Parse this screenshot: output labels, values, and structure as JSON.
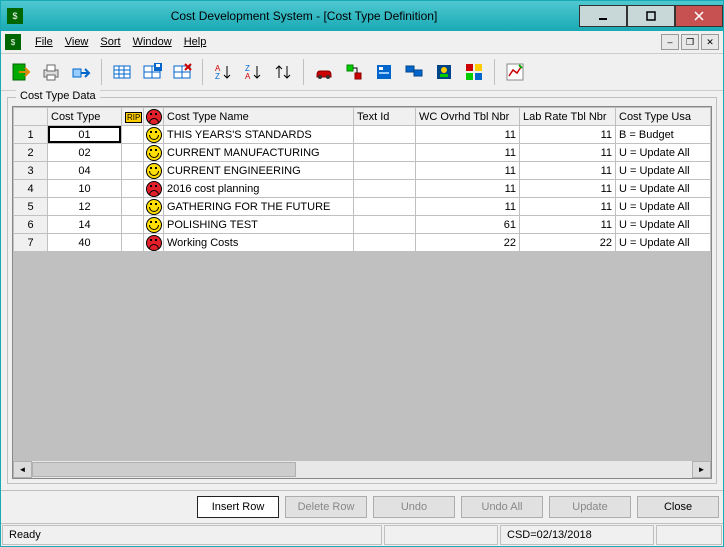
{
  "title": "Cost Development System - [Cost Type Definition]",
  "menu": {
    "file": "File",
    "view": "View",
    "sort": "Sort",
    "window": "Window",
    "help": "Help"
  },
  "group_label": "Cost Type Data",
  "columns": {
    "cost_type": "Cost Type",
    "rip": "RIP",
    "name": "Cost Type Name",
    "text_id": "Text Id",
    "wc": "WC Ovrhd Tbl Nbr",
    "lab": "Lab Rate Tbl Nbr",
    "usage": "Cost Type Usa"
  },
  "rows": [
    {
      "n": "1",
      "ct": "01",
      "face": "yellow",
      "name": "THIS YEARS'S STANDARDS",
      "text": "",
      "wc": "11",
      "lab": "11",
      "usage": "B = Budget"
    },
    {
      "n": "2",
      "ct": "02",
      "face": "yellow",
      "name": "CURRENT MANUFACTURING",
      "text": "",
      "wc": "11",
      "lab": "11",
      "usage": "U = Update All"
    },
    {
      "n": "3",
      "ct": "04",
      "face": "yellow",
      "name": "CURRENT ENGINEERING",
      "text": "",
      "wc": "11",
      "lab": "11",
      "usage": "U = Update All"
    },
    {
      "n": "4",
      "ct": "10",
      "face": "red",
      "name": "2016 cost planning",
      "text": "",
      "wc": "11",
      "lab": "11",
      "usage": "U = Update All"
    },
    {
      "n": "5",
      "ct": "12",
      "face": "yellow",
      "name": "GATHERING FOR THE FUTURE",
      "text": "",
      "wc": "11",
      "lab": "11",
      "usage": "U = Update All"
    },
    {
      "n": "6",
      "ct": "14",
      "face": "yellow",
      "name": "POLISHING TEST",
      "text": "",
      "wc": "61",
      "lab": "11",
      "usage": "U = Update All"
    },
    {
      "n": "7",
      "ct": "40",
      "face": "red",
      "name": "Working Costs",
      "text": "",
      "wc": "22",
      "lab": "22",
      "usage": "U = Update All"
    }
  ],
  "buttons": {
    "insert": "Insert Row",
    "delete": "Delete Row",
    "undo": "Undo",
    "undoall": "Undo All",
    "update": "Update",
    "close": "Close"
  },
  "status": {
    "ready": "Ready",
    "csd": "CSD=02/13/2018"
  }
}
